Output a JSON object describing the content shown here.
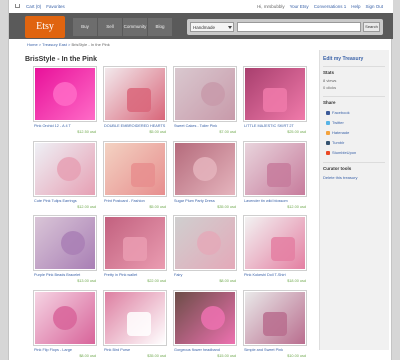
{
  "topbar": {
    "cart": "Cart (0)",
    "favorites": "Favorites",
    "greeting": "Hi, mrsbubbly",
    "links": [
      "Your Etsy",
      "Conversations 1",
      "Help",
      "Sign Out"
    ]
  },
  "header": {
    "logo": "Etsy",
    "nav": [
      "Buy",
      "Sell",
      "Community",
      "Blog"
    ],
    "search_select": "Handmade",
    "search_button": "Search"
  },
  "breadcrumb": {
    "home": "Home",
    "treasury": "Treasury East",
    "current": "BrisStyle - In the Pink"
  },
  "page_title": "BrisStyle - In the Pink",
  "items": [
    {
      "title": "Pink Orchid 12 - A 4 T",
      "price": "$12.50 usd",
      "bg": "#e8119a",
      "accent": "#ff6bc7"
    },
    {
      "title": "DOUBLE EMBROIDERED HEARTS",
      "price": "$5.00 usd",
      "bg": "#f2e9ec",
      "accent": "#d9667a"
    },
    {
      "title": "Sweet Cakes - Toiler Pink",
      "price": "$7.00 usd",
      "bg": "#d9c8cf",
      "accent": "#c89aaa"
    },
    {
      "title": "LITTLE MAJESTIC SKIRT 2T",
      "price": "$25.00 usd",
      "bg": "#a83f6e",
      "accent": "#f07aaa"
    },
    {
      "title": "Cute Pink Tulips Earrings",
      "price": "$12.00 usd",
      "bg": "#eef0f5",
      "accent": "#e6a0b4"
    },
    {
      "title": "Print Postcard - Fashion",
      "price": "$5.00 usd",
      "bg": "#f3d2c2",
      "accent": "#e78e8e"
    },
    {
      "title": "Sugar Plum Party Dress",
      "price": "$35.00 usd",
      "bg": "#b56b7c",
      "accent": "#e5b4bd"
    },
    {
      "title": "Lavender tin wild blossom",
      "price": "$12.00 usd",
      "bg": "#e8d4dc",
      "accent": "#c77b9c"
    },
    {
      "title": "Purple Pink Beads Bracelet",
      "price": "$13.00 usd",
      "bg": "#d9c5d7",
      "accent": "#a97fb5"
    },
    {
      "title": "Pretty in Pink wallet",
      "price": "$22.00 usd",
      "bg": "#c2617f",
      "accent": "#ea9cb1"
    },
    {
      "title": "Fairy",
      "price": "$8.00 usd",
      "bg": "#cfcfcf",
      "accent": "#e4a9b9"
    },
    {
      "title": "Pink Kokeshi Doll T-Shirt",
      "price": "$18.00 usd",
      "bg": "#f2f2f2",
      "accent": "#e47fa2"
    },
    {
      "title": "Pink Flip Flops - Large",
      "price": "$8.00 usd",
      "bg": "#f5d4e3",
      "accent": "#d8649a"
    },
    {
      "title": "Pink Bird Purse",
      "price": "$35.00 usd",
      "bg": "#dd7fa1",
      "accent": "#ffffff"
    },
    {
      "title": "Gorgeous flower headband",
      "price": "$15.00 usd",
      "bg": "#6c4d47",
      "accent": "#ed71b0"
    },
    {
      "title": "Simple and Sweet Pink",
      "price": "$10.00 usd",
      "bg": "#e9e9e9",
      "accent": "#b96d8e"
    }
  ],
  "sidebar": {
    "heading": "Edit my Treasury",
    "stats_title": "Stats",
    "stats": [
      "8 views",
      "0 clicks"
    ],
    "share_title": "Share",
    "share_links": [
      {
        "label": "Facebook",
        "color": "#3b5998"
      },
      {
        "label": "Twitter",
        "color": "#56b3e6"
      },
      {
        "label": "Hatenade",
        "color": "#f4a23b"
      },
      {
        "label": "Tumblr",
        "color": "#34526f"
      },
      {
        "label": "StumbleUpon",
        "color": "#eb4924"
      }
    ],
    "curator_title": "Curator tools",
    "curator_link": "Delete this treasury"
  }
}
